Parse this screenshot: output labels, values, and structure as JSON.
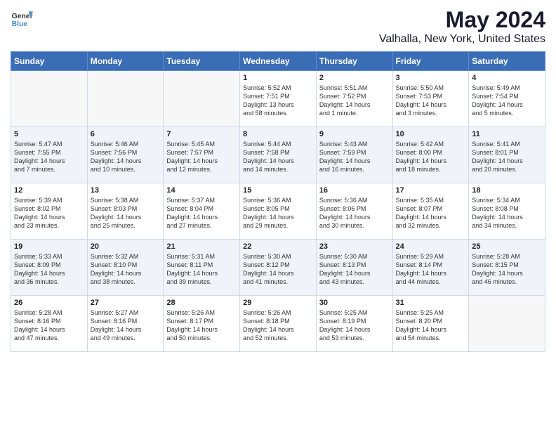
{
  "header": {
    "logo_general": "General",
    "logo_blue": "Blue",
    "title": "May 2024",
    "subtitle": "Valhalla, New York, United States"
  },
  "weekdays": [
    "Sunday",
    "Monday",
    "Tuesday",
    "Wednesday",
    "Thursday",
    "Friday",
    "Saturday"
  ],
  "weeks": [
    [
      {
        "day": "",
        "info": ""
      },
      {
        "day": "",
        "info": ""
      },
      {
        "day": "",
        "info": ""
      },
      {
        "day": "1",
        "info": "Sunrise: 5:52 AM\nSunset: 7:51 PM\nDaylight: 13 hours\nand 58 minutes."
      },
      {
        "day": "2",
        "info": "Sunrise: 5:51 AM\nSunset: 7:52 PM\nDaylight: 14 hours\nand 1 minute."
      },
      {
        "day": "3",
        "info": "Sunrise: 5:50 AM\nSunset: 7:53 PM\nDaylight: 14 hours\nand 3 minutes."
      },
      {
        "day": "4",
        "info": "Sunrise: 5:49 AM\nSunset: 7:54 PM\nDaylight: 14 hours\nand 5 minutes."
      }
    ],
    [
      {
        "day": "5",
        "info": "Sunrise: 5:47 AM\nSunset: 7:55 PM\nDaylight: 14 hours\nand 7 minutes."
      },
      {
        "day": "6",
        "info": "Sunrise: 5:46 AM\nSunset: 7:56 PM\nDaylight: 14 hours\nand 10 minutes."
      },
      {
        "day": "7",
        "info": "Sunrise: 5:45 AM\nSunset: 7:57 PM\nDaylight: 14 hours\nand 12 minutes."
      },
      {
        "day": "8",
        "info": "Sunrise: 5:44 AM\nSunset: 7:58 PM\nDaylight: 14 hours\nand 14 minutes."
      },
      {
        "day": "9",
        "info": "Sunrise: 5:43 AM\nSunset: 7:59 PM\nDaylight: 14 hours\nand 16 minutes."
      },
      {
        "day": "10",
        "info": "Sunrise: 5:42 AM\nSunset: 8:00 PM\nDaylight: 14 hours\nand 18 minutes."
      },
      {
        "day": "11",
        "info": "Sunrise: 5:41 AM\nSunset: 8:01 PM\nDaylight: 14 hours\nand 20 minutes."
      }
    ],
    [
      {
        "day": "12",
        "info": "Sunrise: 5:39 AM\nSunset: 8:02 PM\nDaylight: 14 hours\nand 23 minutes."
      },
      {
        "day": "13",
        "info": "Sunrise: 5:38 AM\nSunset: 8:03 PM\nDaylight: 14 hours\nand 25 minutes."
      },
      {
        "day": "14",
        "info": "Sunrise: 5:37 AM\nSunset: 8:04 PM\nDaylight: 14 hours\nand 27 minutes."
      },
      {
        "day": "15",
        "info": "Sunrise: 5:36 AM\nSunset: 8:05 PM\nDaylight: 14 hours\nand 29 minutes."
      },
      {
        "day": "16",
        "info": "Sunrise: 5:36 AM\nSunset: 8:06 PM\nDaylight: 14 hours\nand 30 minutes."
      },
      {
        "day": "17",
        "info": "Sunrise: 5:35 AM\nSunset: 8:07 PM\nDaylight: 14 hours\nand 32 minutes."
      },
      {
        "day": "18",
        "info": "Sunrise: 5:34 AM\nSunset: 8:08 PM\nDaylight: 14 hours\nand 34 minutes."
      }
    ],
    [
      {
        "day": "19",
        "info": "Sunrise: 5:33 AM\nSunset: 8:09 PM\nDaylight: 14 hours\nand 36 minutes."
      },
      {
        "day": "20",
        "info": "Sunrise: 5:32 AM\nSunset: 8:10 PM\nDaylight: 14 hours\nand 38 minutes."
      },
      {
        "day": "21",
        "info": "Sunrise: 5:31 AM\nSunset: 8:11 PM\nDaylight: 14 hours\nand 39 minutes."
      },
      {
        "day": "22",
        "info": "Sunrise: 5:30 AM\nSunset: 8:12 PM\nDaylight: 14 hours\nand 41 minutes."
      },
      {
        "day": "23",
        "info": "Sunrise: 5:30 AM\nSunset: 8:13 PM\nDaylight: 14 hours\nand 43 minutes."
      },
      {
        "day": "24",
        "info": "Sunrise: 5:29 AM\nSunset: 8:14 PM\nDaylight: 14 hours\nand 44 minutes."
      },
      {
        "day": "25",
        "info": "Sunrise: 5:28 AM\nSunset: 8:15 PM\nDaylight: 14 hours\nand 46 minutes."
      }
    ],
    [
      {
        "day": "26",
        "info": "Sunrise: 5:28 AM\nSunset: 8:16 PM\nDaylight: 14 hours\nand 47 minutes."
      },
      {
        "day": "27",
        "info": "Sunrise: 5:27 AM\nSunset: 8:16 PM\nDaylight: 14 hours\nand 49 minutes."
      },
      {
        "day": "28",
        "info": "Sunrise: 5:26 AM\nSunset: 8:17 PM\nDaylight: 14 hours\nand 50 minutes."
      },
      {
        "day": "29",
        "info": "Sunrise: 5:26 AM\nSunset: 8:18 PM\nDaylight: 14 hours\nand 52 minutes."
      },
      {
        "day": "30",
        "info": "Sunrise: 5:25 AM\nSunset: 8:19 PM\nDaylight: 14 hours\nand 53 minutes."
      },
      {
        "day": "31",
        "info": "Sunrise: 5:25 AM\nSunset: 8:20 PM\nDaylight: 14 hours\nand 54 minutes."
      },
      {
        "day": "",
        "info": ""
      }
    ]
  ]
}
